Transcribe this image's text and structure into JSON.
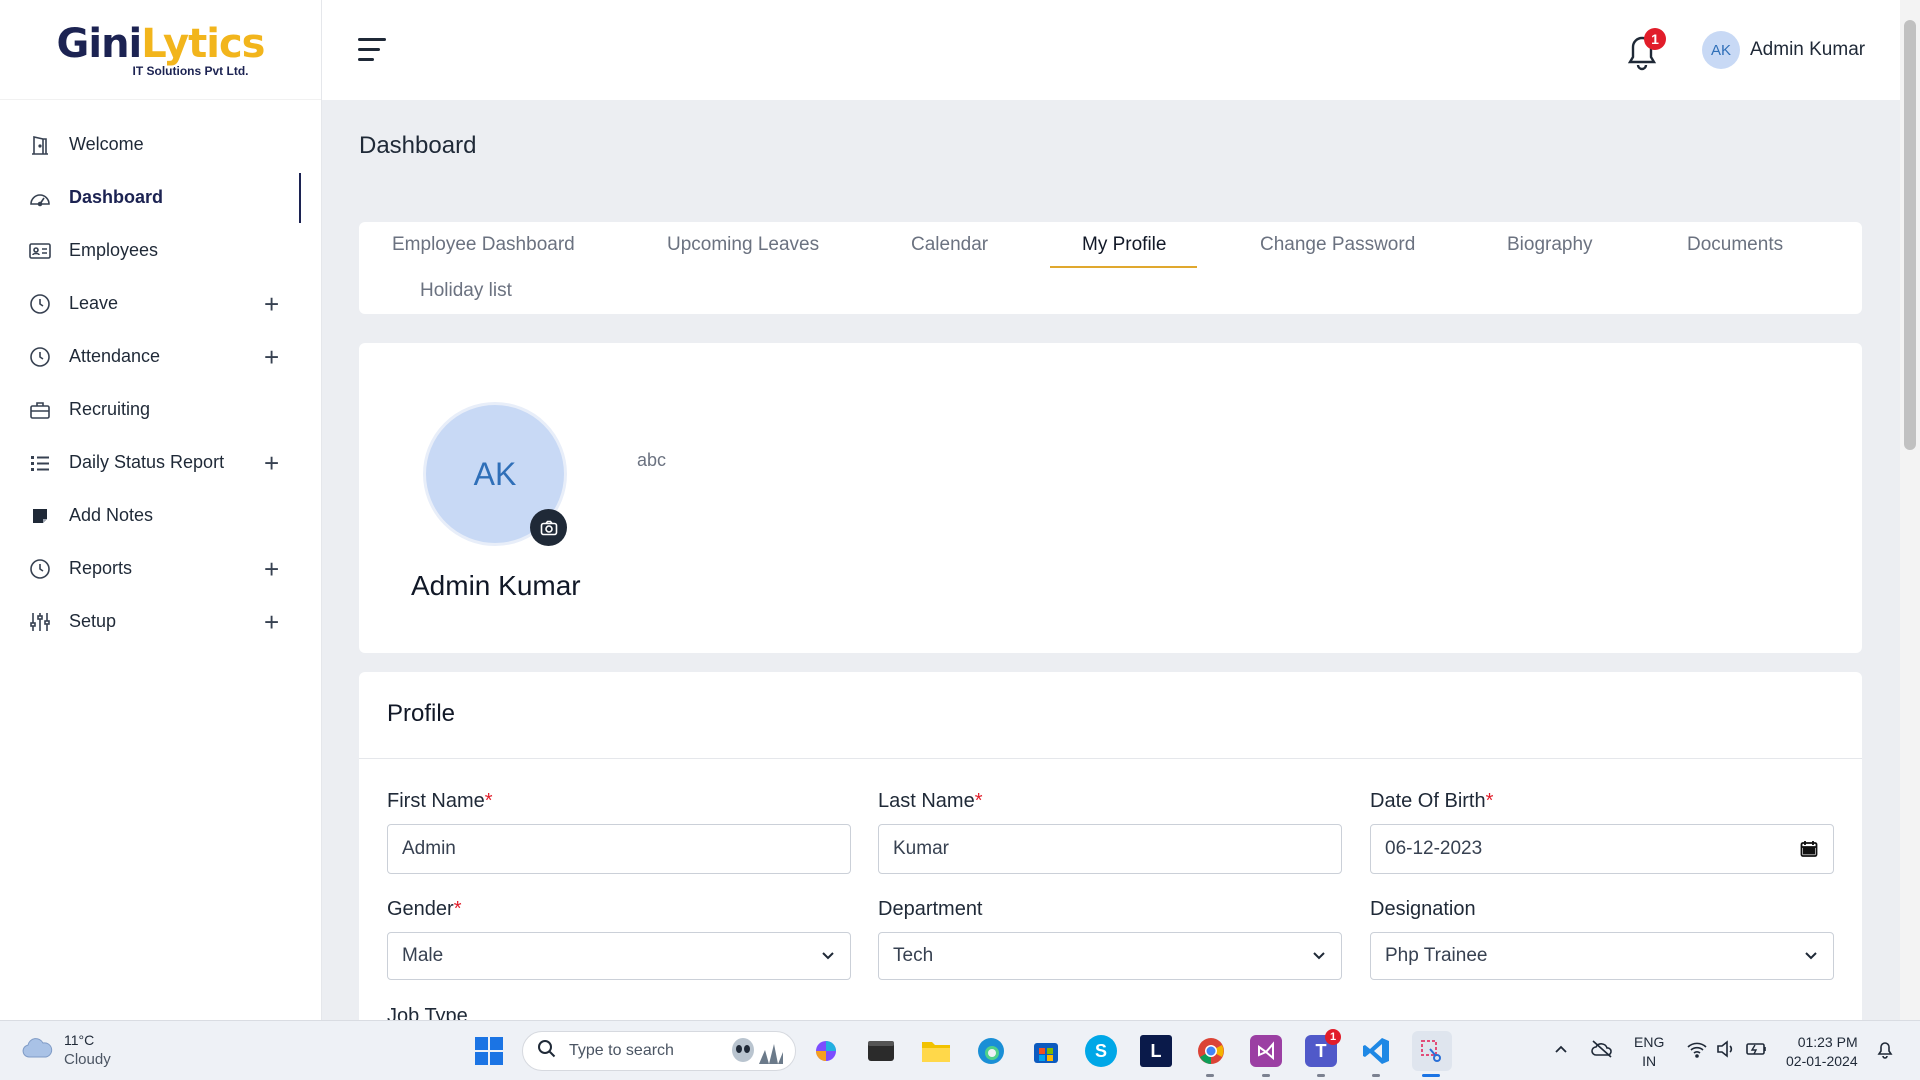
{
  "logo": {
    "brand_part1": "Gini",
    "brand_part2": "Lytics",
    "subtitle": "IT Solutions Pvt Ltd."
  },
  "sidebar": {
    "items": [
      {
        "label": "Welcome",
        "icon": "door-icon",
        "active": false,
        "expandable": false
      },
      {
        "label": "Dashboard",
        "icon": "dashboard-gauge-icon",
        "active": true,
        "expandable": false
      },
      {
        "label": "Employees",
        "icon": "id-card-icon",
        "active": false,
        "expandable": false
      },
      {
        "label": "Leave",
        "icon": "clock-icon",
        "active": false,
        "expandable": true
      },
      {
        "label": "Attendance",
        "icon": "clock-icon",
        "active": false,
        "expandable": true
      },
      {
        "label": "Recruiting",
        "icon": "briefcase-icon",
        "active": false,
        "expandable": false
      },
      {
        "label": "Daily Status Report",
        "icon": "list-icon",
        "active": false,
        "expandable": true
      },
      {
        "label": "Add Notes",
        "icon": "note-icon",
        "active": false,
        "expandable": false
      },
      {
        "label": "Reports",
        "icon": "clock-icon",
        "active": false,
        "expandable": true
      },
      {
        "label": "Setup",
        "icon": "sliders-icon",
        "active": false,
        "expandable": true
      }
    ],
    "expand_symbol": "+"
  },
  "header": {
    "notification_count": "1",
    "user_initials": "AK",
    "user_name": "Admin Kumar"
  },
  "main": {
    "page_title": "Dashboard",
    "tabs": [
      {
        "label": "Employee Dashboard"
      },
      {
        "label": "Upcoming Leaves"
      },
      {
        "label": "Calendar"
      },
      {
        "label": "My Profile",
        "active": true
      },
      {
        "label": "Change Password"
      },
      {
        "label": "Biography"
      },
      {
        "label": "Documents"
      },
      {
        "label": "Holiday list"
      }
    ],
    "profile": {
      "initials": "AK",
      "name": "Admin Kumar",
      "bio": "abc"
    },
    "form": {
      "title": "Profile",
      "required_mark": "*",
      "fields": {
        "first_name": {
          "label": "First Name",
          "value": "Admin",
          "required": true
        },
        "last_name": {
          "label": "Last Name",
          "value": "Kumar",
          "required": true
        },
        "dob": {
          "label": "Date Of Birth",
          "value": "06-12-2023",
          "required": true
        },
        "gender": {
          "label": "Gender",
          "value": "Male",
          "required": true
        },
        "department": {
          "label": "Department",
          "value": "Tech",
          "required": false
        },
        "designation": {
          "label": "Designation",
          "value": "Php Trainee",
          "required": false
        },
        "job_type": {
          "label": "Job Type"
        }
      }
    }
  },
  "taskbar": {
    "weather_temp": "11°C",
    "weather_condition": "Cloudy",
    "search_placeholder": "Type to search",
    "teams_badge": "1",
    "apps": [
      "windows-start-icon",
      "copilot-icon",
      "terminal-icon",
      "file-explorer-icon",
      "edge-icon",
      "store-icon",
      "skype-icon",
      "l-app-icon",
      "chrome-icon",
      "visual-studio-icon",
      "teams-icon",
      "vscode-icon",
      "snipping-tool-icon"
    ],
    "language_line1": "ENG",
    "language_line2": "IN",
    "time": "01:23 PM",
    "date": "02-01-2024"
  },
  "colors": {
    "brand_navy": "#1c2352",
    "brand_yellow": "#f2b51c",
    "tab_accent": "#e0a82e",
    "badge_red": "#e11d2a",
    "avatar_bg": "#c8d9f5"
  }
}
